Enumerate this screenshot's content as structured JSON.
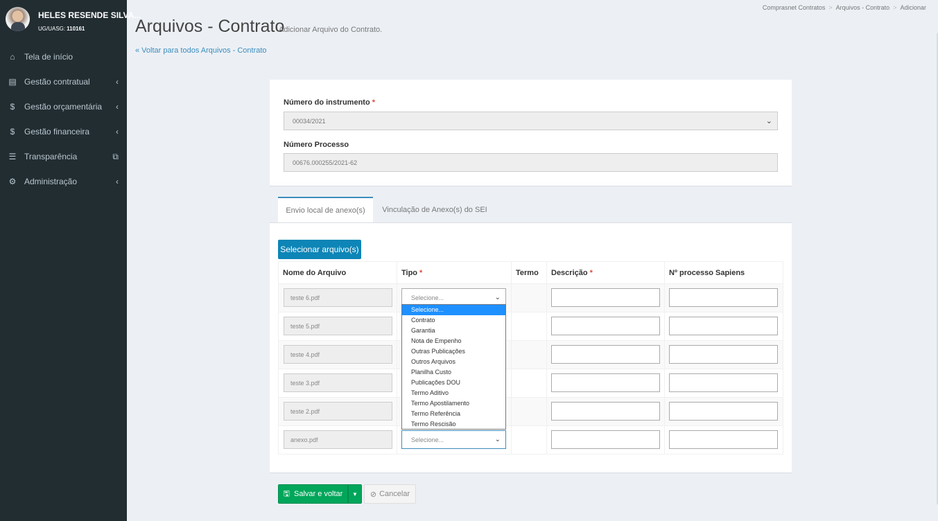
{
  "user": {
    "name": "HELES RESENDE SILVA...",
    "ug_label": "UG/UASG:",
    "ug_value": "110161"
  },
  "sidebar": {
    "items": [
      {
        "label": "Tela de início",
        "icon": "home-icon",
        "glyph": "⌂",
        "arrow": ""
      },
      {
        "label": "Gestão contratual",
        "icon": "file-text-icon",
        "glyph": "▤",
        "arrow": "‹"
      },
      {
        "label": "Gestão orçamentária",
        "icon": "dollar-icon",
        "glyph": "$",
        "arrow": "‹"
      },
      {
        "label": "Gestão financeira",
        "icon": "dollar-icon",
        "glyph": "$",
        "arrow": "‹"
      },
      {
        "label": "Transparência",
        "icon": "list-icon",
        "glyph": "☰",
        "arrow": "⧉"
      },
      {
        "label": "Administração",
        "icon": "cogs-icon",
        "glyph": "⚙",
        "arrow": "‹"
      }
    ]
  },
  "breadcrumb": {
    "items": [
      "Comprasnet Contratos",
      "Arquivos - Contrato",
      "Adicionar"
    ],
    "sep": ">"
  },
  "header": {
    "title": "Arquivos - Contrato",
    "subtitle": "Adicionar Arquivo do Contrato.",
    "back_link": "« Voltar para todos Arquivos - Contrato"
  },
  "form": {
    "instrumento_label": "Número do instrumento",
    "instrumento_value": "00034/2021",
    "processo_label": "Número Processo",
    "processo_value": "00676.000255/2021-62",
    "required_mark": "*"
  },
  "tabs": [
    {
      "label": "Envio local de anexo(s)",
      "active": true
    },
    {
      "label": "Vinculação de Anexo(s) do SEI",
      "active": false
    }
  ],
  "upload": {
    "select_button": "Selecionar arquivo(s)",
    "columns": [
      "Nome do Arquivo",
      "Tipo",
      "Termo",
      "Descrição",
      "Nº processo Sapiens"
    ],
    "rows": [
      {
        "file": "teste 6.pdf",
        "tipo": "Selecione..."
      },
      {
        "file": "teste 5.pdf",
        "tipo": "Selecione..."
      },
      {
        "file": "teste 4.pdf",
        "tipo": "Selecione..."
      },
      {
        "file": "teste 3.pdf",
        "tipo": "Selecione..."
      },
      {
        "file": "teste 2.pdf",
        "tipo": "Selecione..."
      },
      {
        "file": "anexo.pdf",
        "tipo": "Selecione..."
      }
    ],
    "tipo_options": [
      "Selecione...",
      "Contrato",
      "Garantia",
      "Nota de Empenho",
      "Outras Publicações",
      "Outros Arquivos",
      "Planilha Custo",
      "Publicações DOU",
      "Termo Aditivo",
      "Termo Apostilamento",
      "Termo Referência",
      "Termo Rescisão"
    ],
    "tipo_selected": "Selecione..."
  },
  "actions": {
    "save": "Salvar e voltar",
    "cancel": "Cancelar"
  },
  "colors": {
    "sidebar_bg": "#222d32",
    "primary": "#0d85b7",
    "success": "#00a65a",
    "required": "#dd4b39",
    "link": "#3c8dbc"
  }
}
